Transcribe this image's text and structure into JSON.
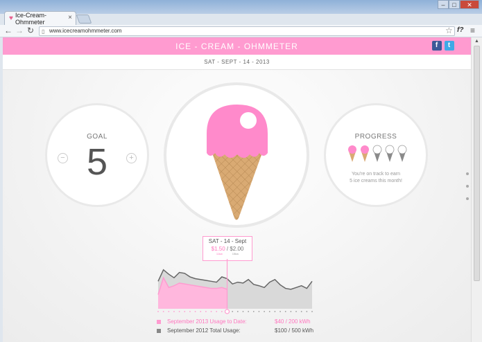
{
  "browser": {
    "tab_title": "Ice-Cream-Ohmmeter",
    "tab_close": "×",
    "url": "www.icecreamohmmeter.com",
    "extension_label": "f?"
  },
  "header": {
    "title": "ICE - CREAM - OHMMETER",
    "facebook": "f",
    "twitter": "t"
  },
  "date_bar": "SAT - SEPT - 14 - 2013",
  "goal": {
    "label": "GOAL",
    "value": "5",
    "minus": "−",
    "plus": "+"
  },
  "progress": {
    "label": "PROGRESS",
    "text_line1": "You're on track to earn",
    "text_line2": "5 ice creams this month!",
    "cones_earned": 2,
    "cones_total": 5
  },
  "tooltip": {
    "date": "SAT - 14 - Sept",
    "current": "$1.50",
    "separator": " / ",
    "previous": "$2.00",
    "current_sub": "11kw",
    "previous_sub": "15kw"
  },
  "legend": [
    {
      "label": "September 2013 Usage to Date:",
      "value": "$40 / 200 kWh"
    },
    {
      "label": "September 2012 Total Usage:",
      "value": "$100 / 500 kWh"
    }
  ],
  "colors": {
    "accent": "#ff9bd0",
    "grey_series": "#d9d9d9",
    "current_series": "#ffb7dd"
  },
  "chart_data": {
    "type": "area",
    "x": [
      1,
      2,
      3,
      4,
      5,
      6,
      7,
      8,
      9,
      10,
      11,
      12,
      13,
      14,
      15,
      16,
      17,
      18,
      19,
      20,
      21,
      22,
      23,
      24,
      25,
      26,
      27,
      28,
      29,
      30
    ],
    "series": [
      {
        "values": [
          62,
          88,
          78,
          70,
          82,
          80,
          72,
          68,
          66,
          64,
          62,
          60,
          72,
          68,
          56,
          60,
          58,
          66,
          55,
          52,
          48,
          60,
          66,
          54,
          46,
          44,
          48,
          52,
          46,
          62
        ]
      },
      {
        "values": [
          32,
          70,
          48,
          52,
          58,
          56,
          54,
          52,
          50,
          48,
          46,
          46,
          48,
          44
        ]
      }
    ],
    "ylim": [
      0,
      100
    ]
  }
}
